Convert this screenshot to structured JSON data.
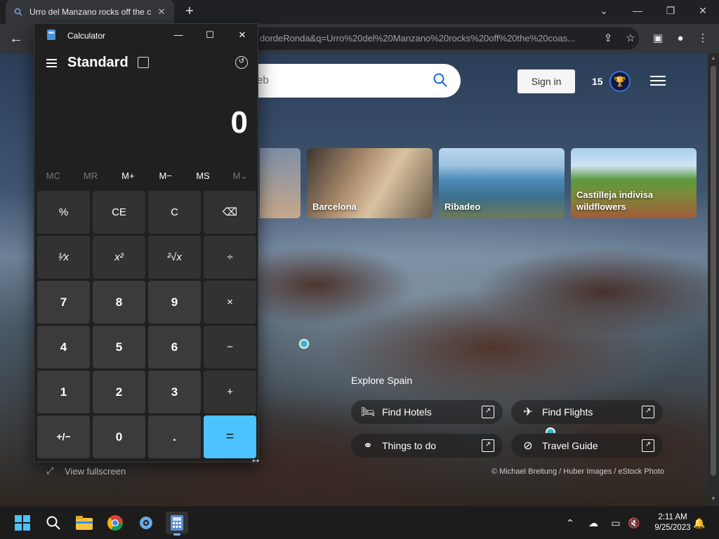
{
  "browser": {
    "tab_title": "Urro del Manzano rocks off the c",
    "url_fragment": "dordeRonda&q=Urro%20del%20Manzano%20rocks%20off%20the%20coas..."
  },
  "bing": {
    "search_placeholder": "eb",
    "sign_in": "Sign in",
    "points": "15",
    "cards": [
      {
        "label": ""
      },
      {
        "label": "Barcelona"
      },
      {
        "label": "Ribadeo"
      },
      {
        "label": "Castilleja indivisa wildflowers"
      }
    ],
    "explore_title": "Explore Spain",
    "actions": [
      {
        "label": "Find Hotels",
        "icon": "bed-icon"
      },
      {
        "label": "Find Flights",
        "icon": "airplane-icon"
      },
      {
        "label": "Things to do",
        "icon": "binoculars-icon"
      },
      {
        "label": "Travel Guide",
        "icon": "compass-icon"
      }
    ],
    "credit": "© Michael Breitung / Huber Images / eStock Photo",
    "view_fullscreen": "View fullscreen"
  },
  "calculator": {
    "window_title": "Calculator",
    "mode": "Standard",
    "display_value": "0",
    "memory": [
      "MC",
      "MR",
      "M+",
      "M−",
      "MS",
      "M⌄"
    ],
    "keys": [
      [
        "%",
        "CE",
        "C",
        "⌫"
      ],
      [
        "¹⁄x",
        "x²",
        "²√x",
        "÷"
      ],
      [
        "7",
        "8",
        "9",
        "×"
      ],
      [
        "4",
        "5",
        "6",
        "−"
      ],
      [
        "1",
        "2",
        "3",
        "+"
      ],
      [
        "+/−",
        "0",
        ".",
        "="
      ]
    ]
  },
  "taskbar": {
    "time": "2:11 AM",
    "date": "9/25/2023"
  },
  "colors": {
    "accent_equals": "#4cc2ff",
    "taskbar_bg": "#1c1c1c"
  }
}
